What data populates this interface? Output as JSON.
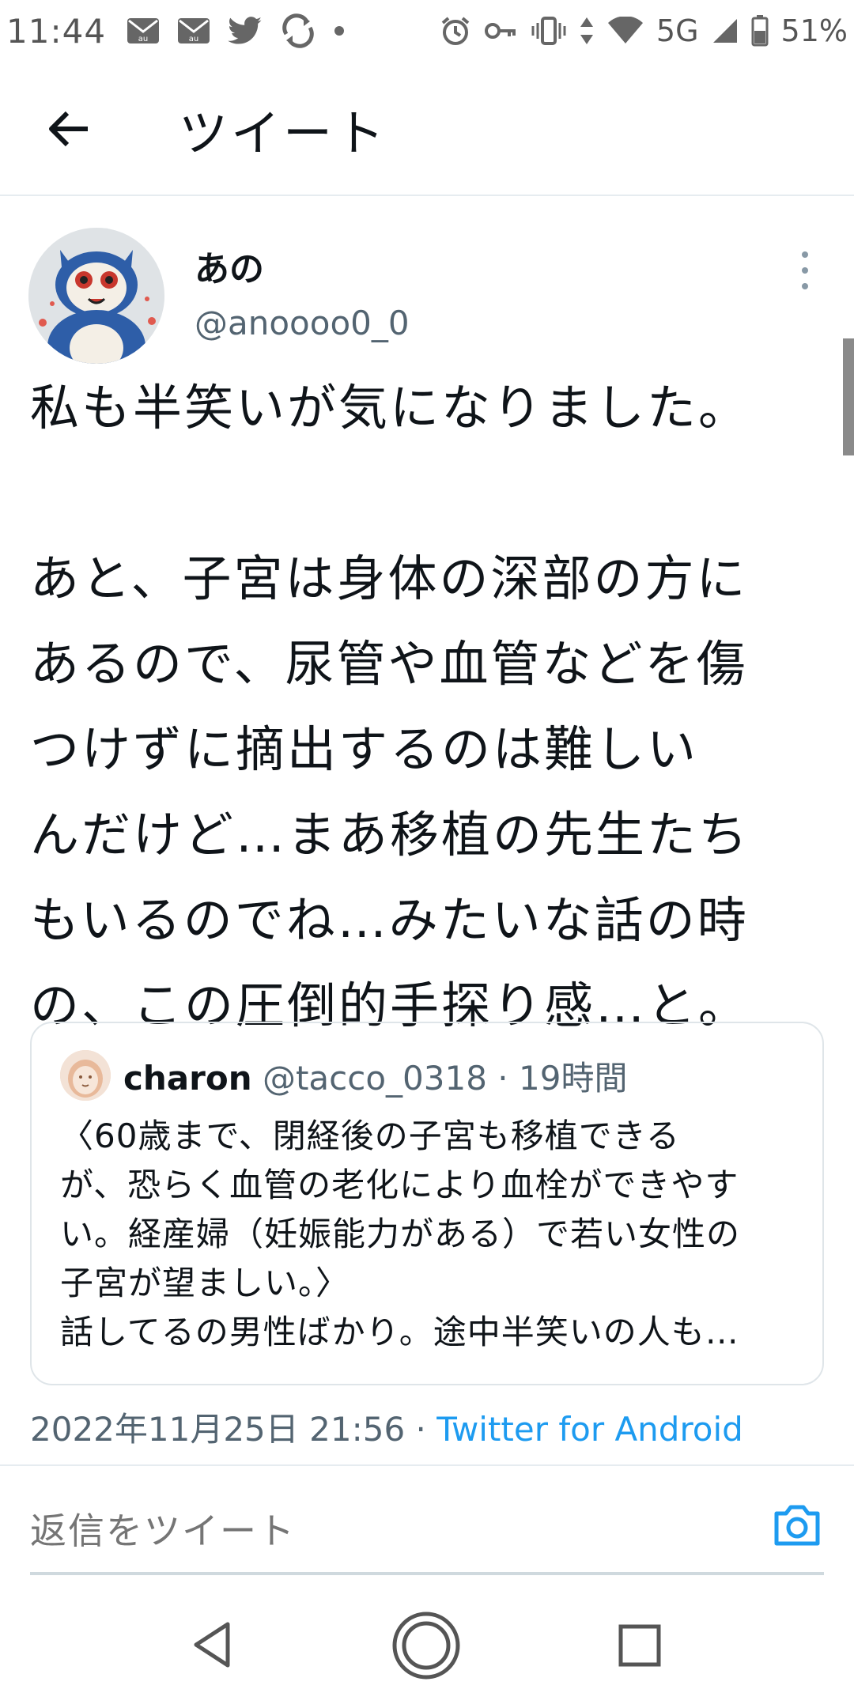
{
  "status_bar": {
    "time": "11:44",
    "left_icons": [
      "au-mail-icon",
      "au-mail-icon",
      "twitter-icon",
      "sync-icon",
      "dot-icon"
    ],
    "right_icons": [
      "alarm-icon",
      "key-icon",
      "vibrate-icon",
      "data-arrows-icon",
      "wifi-icon"
    ],
    "network": "5G",
    "battery": "51%"
  },
  "header": {
    "title": "ツイート"
  },
  "tweet": {
    "author_name": "あの",
    "author_handle": "@anoooo0_0",
    "text": "私も半笑いが気になりました。\n\nあと、子宮は身体の深部の方に\nあるので、尿管や血管などを傷\nつけずに摘出するのは難しい\nんだけど…まあ移植の先生たち\nもいるのでね…みたいな話の時\nの、この圧倒的手探り感…と。",
    "date": "2022年11月25日 21:56",
    "separator": " · ",
    "source": "Twitter for Android"
  },
  "quote": {
    "name": "charon",
    "handle": "@tacco_0318",
    "separator": " · ",
    "time": "19時間",
    "text": "〈60歳まで、閉経後の子宮も移植できる\nが、恐らく血管の老化により血栓ができやす\nい。経産婦（妊娠能力がある）で若い女性の\n子宮が望ましい。〉\n話してるの男性ばかり。途中半笑いの人も…"
  },
  "reply": {
    "placeholder": "返信をツイート"
  },
  "colors": {
    "link_blue": "#1d9bf0",
    "secondary_text": "#536471",
    "primary_text": "#0f1419",
    "border": "#dfe5e9"
  }
}
